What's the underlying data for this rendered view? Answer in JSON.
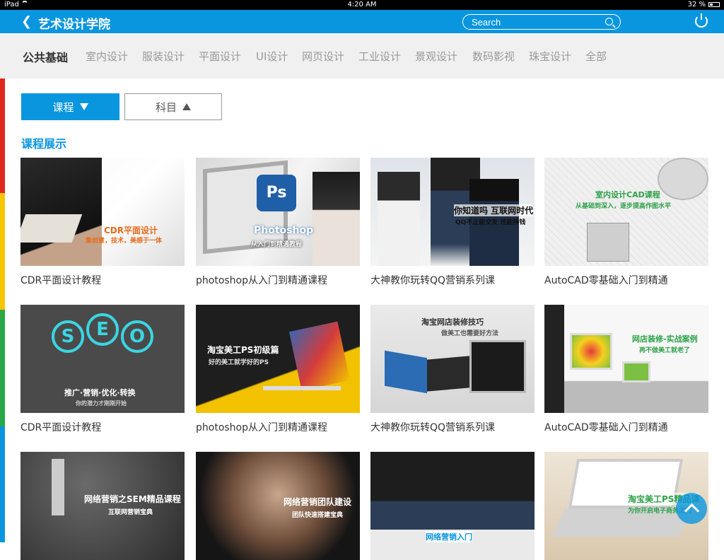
{
  "status": {
    "device": "iPad",
    "time": "4:20 AM",
    "battery": "32 %"
  },
  "nav": {
    "back_icon": "chevron-left-icon",
    "title": "艺术设计学院",
    "search_placeholder": "Search",
    "power_icon": "power-icon"
  },
  "categories": [
    "公共基础",
    "室内设计",
    "服装设计",
    "平面设计",
    "UI设计",
    "网页设计",
    "工业设计",
    "景观设计",
    "数码影视",
    "珠宝设计",
    "全部"
  ],
  "filters": {
    "course": "课程",
    "subject": "科目"
  },
  "section_title": "课程展示",
  "colors": {
    "accent": "#0a96df",
    "sidebar": [
      "#e1261c",
      "#f7c600",
      "#2aa84a",
      "#0a96df"
    ]
  },
  "courses": [
    {
      "title": "CDR平面设计教程",
      "thumb": [
        "CDR平面设计",
        "集创意，技术，美感于一体"
      ]
    },
    {
      "title": "photoshop从入门到精通课程",
      "thumb": [
        "Photoshop",
        "从入门到精通教程"
      ]
    },
    {
      "title": "大神教你玩转QQ营销系列课",
      "thumb": [
        "你知道吗 互联网时代",
        "QQ不止能交友 还能挣钱"
      ]
    },
    {
      "title": "AutoCAD零基础入门到精通",
      "thumb": [
        "室内设计CAD课程",
        "从基础到深入，逐步提高作图水平"
      ]
    },
    {
      "title": "CDR平面设计教程",
      "thumb": [
        "推广·营销·优化·转换",
        "你的潜力才刚刚开始"
      ]
    },
    {
      "title": "photoshop从入门到精通课程",
      "thumb": [
        "淘宝美工PS初级篇",
        "好的美工就学好的PS"
      ]
    },
    {
      "title": "大神教你玩转QQ营销系列课",
      "thumb": [
        "淘宝网店装修技巧",
        "做美工也需要好方法"
      ]
    },
    {
      "title": "AutoCAD零基础入门到精通",
      "thumb": [
        "网店装修-实战案例",
        "再不做美工就老了"
      ]
    },
    {
      "title": "",
      "thumb": [
        "网络营销之SEM精品课程",
        "互联网营销宝典"
      ]
    },
    {
      "title": "",
      "thumb": [
        "网络营销团队建设",
        "团队快速搭建宝典"
      ]
    },
    {
      "title": "",
      "thumb": [
        "网络营销入门",
        ""
      ]
    },
    {
      "title": "",
      "thumb": [
        "淘宝美工PS精品课",
        "为你开启电子商务之门"
      ]
    }
  ]
}
